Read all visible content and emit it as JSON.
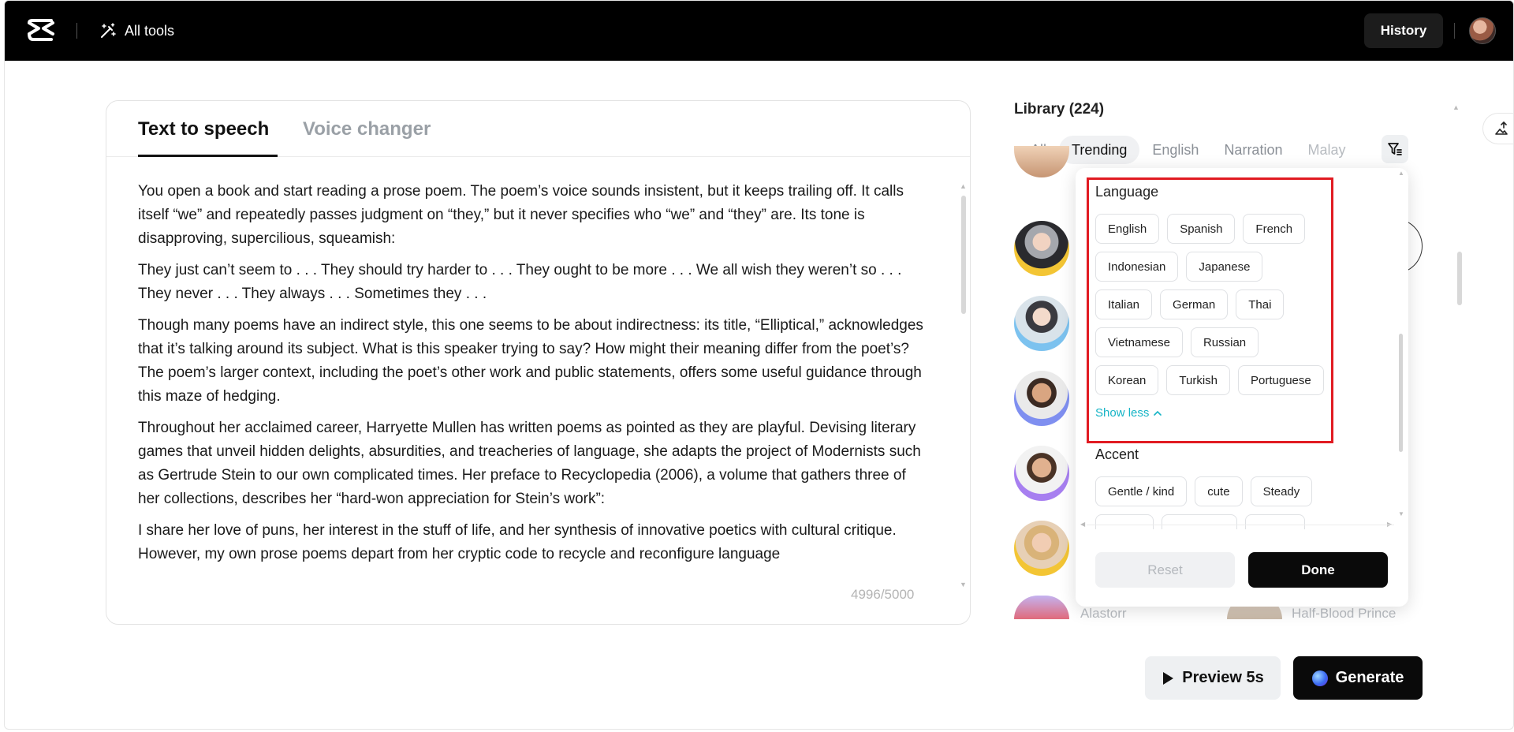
{
  "header": {
    "all_tools_label": "All tools",
    "history_label": "History"
  },
  "editor": {
    "tabs": [
      {
        "label": "Text to speech",
        "active": true
      },
      {
        "label": "Voice changer",
        "active": false
      }
    ],
    "paragraphs": [
      "You open a book and start reading a prose poem. The poem’s voice sounds insistent, but it keeps trailing off. It calls itself “we” and repeatedly passes judgment on “they,” but it never specifies who “we” and “they” are. Its tone is disapproving, supercilious, squeamish:",
      "They just can’t seem to . . . They should try harder to . . . They ought to be more . . . We all wish they weren’t so . . . They never . . . They always . . . Sometimes they . . .",
      "Though many poems have an indirect style, this one seems to be about indirectness: its title, “Elliptical,” acknowledges that it’s talking around its subject. What is this speaker trying to say? How might their meaning differ from the poet’s? The poem’s larger context, including the poet’s other work and public statements, offers some useful guidance through this maze of hedging.",
      "Throughout her acclaimed career, Harryette Mullen has written poems as pointed as they are playful. Devising literary games that unveil hidden delights, absurdities, and treacheries of language, she adapts the project of Modernists such as Gertrude Stein to our own complicated times. Her preface to Recyclopedia (2006), a volume that gathers three of her collections, describes her “hard-won appreciation for Stein’s work”:",
      "I share her love of puns, her interest in the stuff of life, and her synthesis of innovative poetics with cultural critique. However, my own prose poems depart from her cryptic code to recycle and reconfigure language"
    ],
    "char_count": "4996/5000"
  },
  "library": {
    "title": "Library (224)",
    "chips": [
      {
        "label": "All",
        "active": false
      },
      {
        "label": "Trending",
        "active": true
      },
      {
        "label": "English",
        "active": false
      },
      {
        "label": "Narration",
        "active": false
      },
      {
        "label": "Malay",
        "active": false
      }
    ],
    "visible_names": [
      "Alastorr",
      "Half-Blood Prince"
    ]
  },
  "filter_popup": {
    "language_title": "Language",
    "languages": [
      "English",
      "Spanish",
      "French",
      "Indonesian",
      "Japanese",
      "Italian",
      "German",
      "Thai",
      "Vietnamese",
      "Russian",
      "Korean",
      "Turkish",
      "Portuguese"
    ],
    "show_less_label": "Show less",
    "accent_title": "Accent",
    "accents": [
      "Gentle / kind",
      "cute",
      "Steady"
    ],
    "reset_label": "Reset",
    "done_label": "Done",
    "highlight_color": "#e11b22"
  },
  "actions": {
    "preview_label": "Preview 5s",
    "generate_label": "Generate"
  },
  "icons": [
    "capcut-logo-icon",
    "magic-wand-icon",
    "filter-icon",
    "image-upload-icon",
    "play-icon",
    "chevron-up-icon"
  ]
}
